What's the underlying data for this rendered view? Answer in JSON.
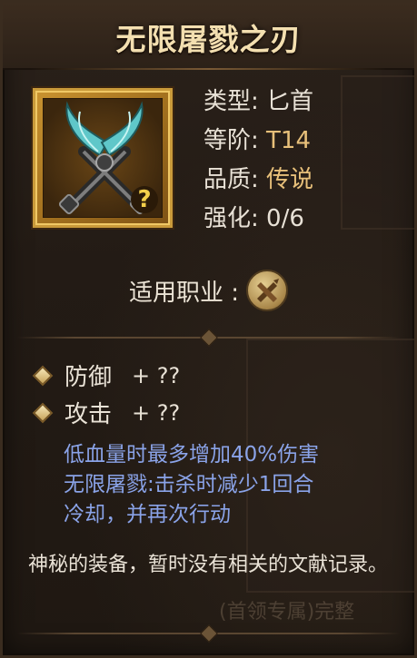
{
  "item": {
    "name": "无限屠戮之刃",
    "type_label": "类型: ",
    "type_value": "匕首",
    "tier_label": "等阶: ",
    "tier_value": "T14",
    "quality_label": "品质: ",
    "quality_value": "传说",
    "enhance_label": "强化: ",
    "enhance_value": "0/6",
    "unknown_badge": "?",
    "icon": "twin-daggers-icon"
  },
  "class_row": {
    "label": "适用职业 :",
    "icon": "dagger-class-icon"
  },
  "attributes": [
    {
      "name": "防御",
      "value": "+ ??"
    },
    {
      "name": "攻击",
      "value": "+ ??"
    }
  ],
  "effect_lines": [
    "低血量时最多增加40%伤害",
    "无限屠戮:击杀时减少1回合",
    "冷却，并再次行动"
  ],
  "description": "神秘的装备，暂时没有相关的文献记录。",
  "background_text": "(首领专属)完整",
  "colors": {
    "title": "#f3dfb0",
    "gold_value": "#e8c07a",
    "effect": "#8aa3e8",
    "frame": "#c99a3a"
  }
}
